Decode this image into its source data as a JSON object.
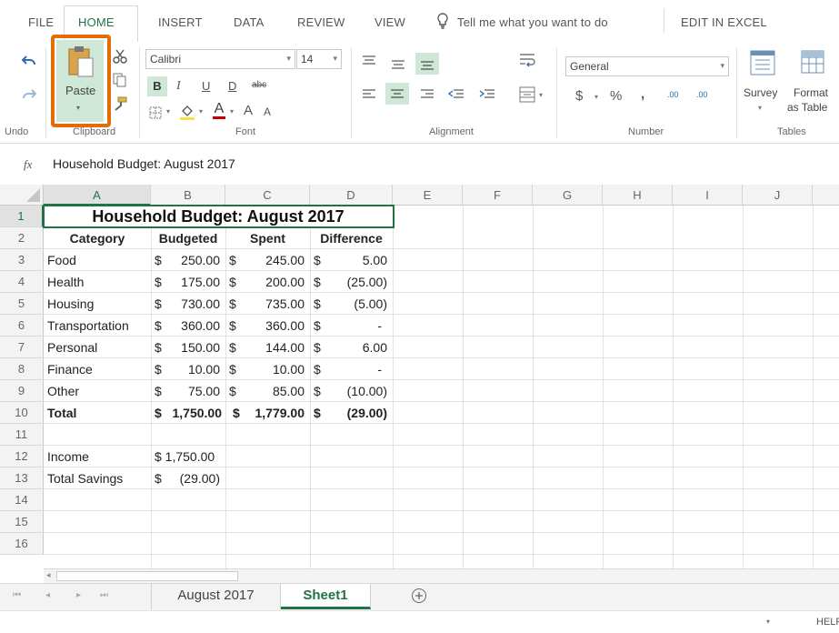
{
  "menu": {
    "tabs": [
      "FILE",
      "HOME",
      "INSERT",
      "DATA",
      "REVIEW",
      "VIEW"
    ],
    "tell_me": "Tell me what you want to do",
    "edit_in_excel": "EDIT IN EXCEL"
  },
  "ribbon": {
    "undo_label": "Undo",
    "clipboard_label": "Clipboard",
    "paste_label": "Paste",
    "font_name": "Calibri",
    "font_size": "14",
    "font_label": "Font",
    "bold": "B",
    "italic": "I",
    "underline": "U",
    "double_underline": "D",
    "strike": "abc",
    "grow_font": "A",
    "shrink_font": "A",
    "font_color": "A",
    "alignment_label": "Alignment",
    "number_format": "General",
    "dollar": "$",
    "percent": "%",
    "comma": ",",
    "inc_decimal": ".00",
    "dec_decimal": ".00",
    "number_label": "Number",
    "survey_label": "Survey",
    "format_table_1": "Format",
    "format_table_2": "as Table",
    "tables_label": "Tables"
  },
  "formula_bar": {
    "fx": "fx",
    "value": "Household Budget: August 2017"
  },
  "columns": [
    "A",
    "B",
    "C",
    "D",
    "E",
    "F",
    "G",
    "H",
    "I",
    "J"
  ],
  "rows": [
    "1",
    "2",
    "3",
    "4",
    "5",
    "6",
    "7",
    "8",
    "9",
    "10",
    "11",
    "12",
    "13",
    "14",
    "15",
    "16"
  ],
  "sheet": {
    "title": "Household Budget: August 2017",
    "headers": [
      "Category",
      "Budgeted",
      "Spent",
      "Difference"
    ],
    "items": [
      {
        "category": "Food",
        "budgeted": "250.00",
        "spent": "245.00",
        "difference": "5.00"
      },
      {
        "category": "Health",
        "budgeted": "175.00",
        "spent": "200.00",
        "difference": "(25.00)"
      },
      {
        "category": "Housing",
        "budgeted": "730.00",
        "spent": "735.00",
        "difference": "(5.00)"
      },
      {
        "category": "Transportation",
        "budgeted": "360.00",
        "spent": "360.00",
        "difference": "-"
      },
      {
        "category": "Personal",
        "budgeted": "150.00",
        "spent": "144.00",
        "difference": "6.00"
      },
      {
        "category": "Finance",
        "budgeted": "10.00",
        "spent": "10.00",
        "difference": "-"
      },
      {
        "category": "Other",
        "budgeted": "75.00",
        "spent": "85.00",
        "difference": "(10.00)"
      }
    ],
    "total": {
      "category": "Total",
      "budgeted": "1,750.00",
      "spent": "1,779.00",
      "difference": "(29.00)"
    },
    "income_label": "Income",
    "income_value": "$ 1,750.00",
    "savings_label": "Total Savings",
    "savings_value": "(29.00)",
    "currency": "$"
  },
  "sheet_tabs": [
    "August 2017",
    "Sheet1"
  ],
  "status": {
    "help": "HELP"
  },
  "colors": {
    "accent": "#217346",
    "highlight": "#e36c09"
  }
}
